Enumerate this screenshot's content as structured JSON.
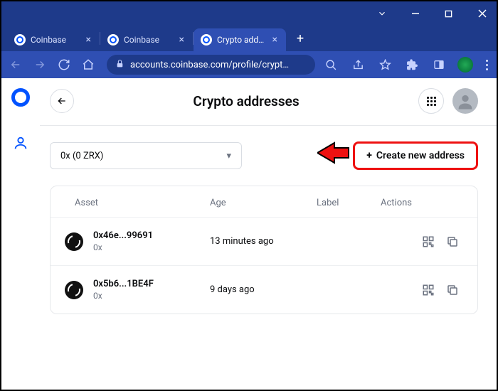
{
  "window": {
    "tabs": [
      {
        "title": "Coinbase",
        "active": false
      },
      {
        "title": "Coinbase",
        "active": false
      },
      {
        "title": "Crypto add…",
        "active": true
      }
    ],
    "url_display": "accounts.coinbase.com/profile/crypt…"
  },
  "page": {
    "title": "Crypto addresses",
    "dropdown_selected": "0x (0 ZRX)",
    "create_button_label": "Create new address"
  },
  "table": {
    "headers": {
      "asset": "Asset",
      "age": "Age",
      "label": "Label",
      "actions": "Actions"
    },
    "rows": [
      {
        "address": "0x46e...99691",
        "symbol": "0x",
        "age": "13 minutes ago"
      },
      {
        "address": "0x5b6...1BE4F",
        "symbol": "0x",
        "age": "9 days ago"
      }
    ]
  }
}
